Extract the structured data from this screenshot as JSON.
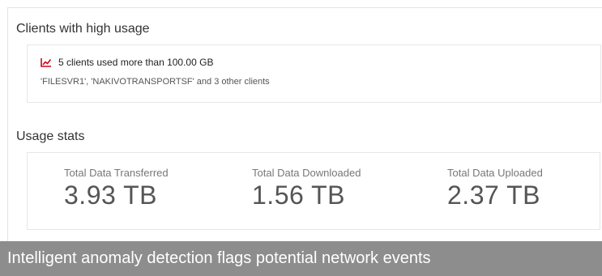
{
  "high_usage": {
    "title": "Clients with high usage",
    "icon": "trend-up-chart-icon",
    "alert_text": "5 clients used more than 100.00 GB",
    "clients_text": "'FILESVR1', 'NAKIVOTRANSPORTSF' and 3 other clients",
    "alert_color": "#d0021b"
  },
  "usage_stats": {
    "title": "Usage stats",
    "stats": [
      {
        "label": "Total Data Transferred",
        "value": "3.93 TB"
      },
      {
        "label": "Total Data Downloaded",
        "value": "1.56 TB"
      },
      {
        "label": "Total Data Uploaded",
        "value": "2.37 TB"
      }
    ]
  },
  "caption": {
    "text": "Intelligent anomaly detection flags potential network events",
    "background": "#8d8d8d"
  }
}
